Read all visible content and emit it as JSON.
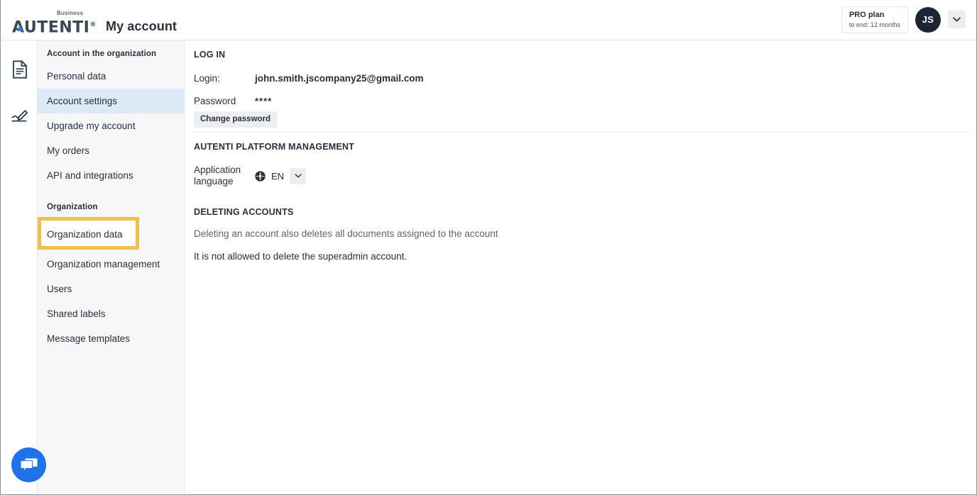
{
  "header": {
    "logo_business": "Business",
    "logo_text": "AUTENTI",
    "logo_registered": "®",
    "page_title": "My account",
    "plan": {
      "name": "PRO plan",
      "expiry": "to end: 12 months"
    },
    "avatar_initials": "JS",
    "dropdown_icon": "chevron-down-icon"
  },
  "rail": {
    "items": [
      {
        "icon": "document-icon",
        "name": "documents"
      },
      {
        "icon": "signature-pen-icon",
        "name": "signatures"
      }
    ]
  },
  "sidebar": {
    "groups": [
      {
        "label": "Account in the organization",
        "items": [
          {
            "label": "Personal data",
            "active": false,
            "highlighted": false
          },
          {
            "label": "Account settings",
            "active": true,
            "highlighted": false
          },
          {
            "label": "Upgrade my account",
            "active": false,
            "highlighted": false
          },
          {
            "label": "My orders",
            "active": false,
            "highlighted": false
          },
          {
            "label": "API and integrations",
            "active": false,
            "highlighted": false
          }
        ]
      },
      {
        "label": "Organization",
        "items": [
          {
            "label": "Organization data",
            "active": false,
            "highlighted": true
          },
          {
            "label": "Organization management",
            "active": false,
            "highlighted": false
          },
          {
            "label": "Users",
            "active": false,
            "highlighted": false
          },
          {
            "label": "Shared labels",
            "active": false,
            "highlighted": false
          },
          {
            "label": "Message templates",
            "active": false,
            "highlighted": false
          }
        ]
      }
    ]
  },
  "main": {
    "login_section": {
      "heading": "LOG IN",
      "login_label": "Login:",
      "login_value": "john.smith.jscompany25@gmail.com",
      "password_label": "Password",
      "password_value": "****",
      "change_password_button": "Change password"
    },
    "platform_section": {
      "heading": "AUTENTI PLATFORM MANAGEMENT",
      "language_label": "Application language",
      "language_label_line1": "Application",
      "language_label_line2": "language",
      "language_icon": "globe-icon",
      "language_value": "EN",
      "language_chevron": "chevron-down-icon"
    },
    "deleting_section": {
      "heading": "DELETING ACCOUNTS",
      "description": "Deleting an account also deletes all documents assigned to the account",
      "notice": "It is not allowed to delete the superadmin account."
    }
  },
  "chat": {
    "icon": "chat-bubbles-icon",
    "label": "Chat"
  },
  "colors": {
    "accent_blue": "#1f72e8",
    "active_item_bg": "#dbeaf6",
    "highlight_annotation": "#f0bf4c",
    "sidebar_bg": "#f7f7f8",
    "avatar_bg": "#1b2533",
    "text_primary": "#28303f",
    "text_muted": "#5c6573",
    "button_gray": "#eceef1"
  }
}
